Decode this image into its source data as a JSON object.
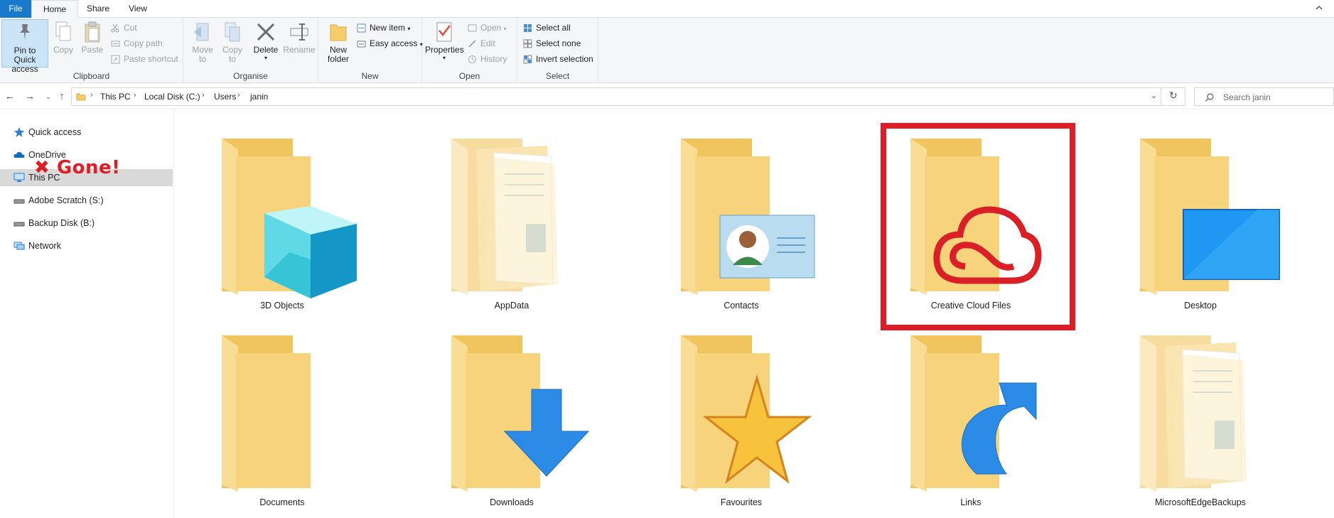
{
  "ribbon_tabs": {
    "file": "File",
    "home": "Home",
    "share": "Share",
    "view": "View"
  },
  "clipboard": {
    "pin_line1": "Pin to Quick",
    "pin_line2": "access",
    "copy": "Copy",
    "paste": "Paste",
    "cut": "Cut",
    "copy_path": "Copy path",
    "paste_shortcut": "Paste shortcut",
    "label": "Clipboard"
  },
  "organise": {
    "move_line1": "Move",
    "move_line2": "to",
    "copy_line1": "Copy",
    "copy_line2": "to",
    "delete": "Delete",
    "rename": "Rename",
    "label": "Organise"
  },
  "new_group": {
    "new_folder_line1": "New",
    "new_folder_line2": "folder",
    "new_item": "New item",
    "easy_access": "Easy access",
    "label": "New"
  },
  "open_group": {
    "properties": "Properties",
    "open": "Open",
    "edit": "Edit",
    "history": "History",
    "label": "Open"
  },
  "select_group": {
    "select_all": "Select all",
    "select_none": "Select none",
    "invert_selection": "Invert selection",
    "label": "Select"
  },
  "address": {
    "crumbs": [
      "This PC",
      "Local Disk (C:)",
      "Users",
      "janin"
    ]
  },
  "search": {
    "placeholder": "Search janin"
  },
  "sidebar": {
    "items": [
      "Quick access",
      "OneDrive",
      "This PC",
      "Adobe Scratch (S:)",
      "Backup Disk (B:)",
      "Network"
    ]
  },
  "annotation": {
    "gone_text": "✖ Gone!"
  },
  "folders": [
    "3D Objects",
    "AppData",
    "Contacts",
    "Creative Cloud Files",
    "Desktop",
    "Documents",
    "Downloads",
    "Favourites",
    "Links",
    "MicrosoftEdgeBackups"
  ],
  "colors": {
    "file_tab": "#1979ca",
    "folder": "#f5cd6b",
    "highlight": "#e01d24",
    "cc_red": "#da1f26",
    "accent_blue": "#2b8be6"
  }
}
